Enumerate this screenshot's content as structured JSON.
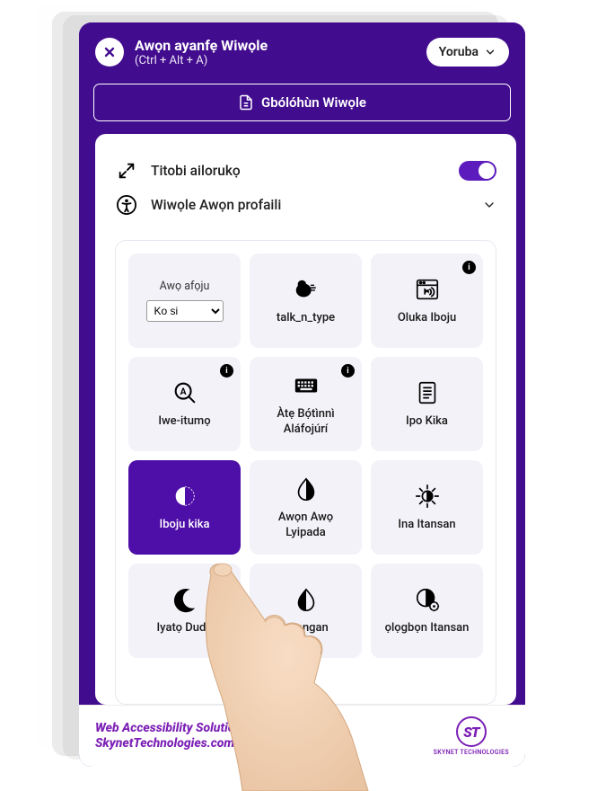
{
  "header": {
    "title": "Awọn ayanfẹ Wiwọle",
    "subtitle": "(Ctrl + Alt + A)",
    "language": "Yoruba"
  },
  "statement": "Gbólóhùn Wiwọle",
  "oversize": {
    "label": "Titobi ailorukọ"
  },
  "profiles": {
    "label": "Wiwọle Awọn profaili"
  },
  "tiles": {
    "colorblind": {
      "title": "Awọ afọju",
      "selected": "Ko si"
    },
    "talk": {
      "label": "talk_n_type"
    },
    "screenreader": {
      "label": "Oluka Iboju"
    },
    "dictionary": {
      "label": "Iwe-itumọ"
    },
    "virtualkb": {
      "label": "Àtẹ Bọ́tìnnì Aláfojúrí"
    },
    "reading": {
      "label": "Ipo Kika"
    },
    "readingmask": {
      "label": "Iboju kika"
    },
    "invert": {
      "label": "Awọn Awọ Lyipada"
    },
    "lightcontrast": {
      "label": "Ina Itansan"
    },
    "darkcontrast": {
      "label": "Iyatọ Dudu"
    },
    "monochrome": {
      "label": "ọgangan"
    },
    "smartcontrast": {
      "label": "ọlọgbọn Itansan"
    }
  },
  "footer": {
    "line1": "Web Accessibility Solution By",
    "line2": "SkynetTechnologies.com",
    "logo_text": "ST",
    "logo_caption": "SKYNET TECHNOLOGIES"
  },
  "info_badge": "i"
}
